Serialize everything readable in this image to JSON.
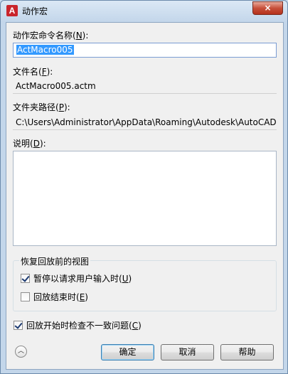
{
  "window": {
    "title": "动作宏",
    "app_icon": "A",
    "close_glyph": "×"
  },
  "form": {
    "macro_name": {
      "label_prefix": "动作宏命令名称(",
      "label_key": "N",
      "label_suffix": "):",
      "value": "ActMacro005"
    },
    "file_name": {
      "label_prefix": "文件名(",
      "label_key": "F",
      "label_suffix": "):",
      "value": "ActMacro005.actm"
    },
    "folder_path": {
      "label_prefix": "文件夹路径(",
      "label_key": "P",
      "label_suffix": "):",
      "value": "C:\\Users\\Administrator\\AppData\\Roaming\\Autodesk\\AutoCAD"
    },
    "description": {
      "label_prefix": "说明(",
      "label_key": "D",
      "label_suffix": "):",
      "value": ""
    }
  },
  "restore_group": {
    "title": "恢复回放前的视图",
    "pause_option": {
      "label_prefix": "暂停以请求用户输入时(",
      "label_key": "U",
      "label_suffix": ")",
      "checked": true
    },
    "end_option": {
      "label_prefix": "回放结束时(",
      "label_key": "E",
      "label_suffix": ")",
      "checked": false
    }
  },
  "check_option": {
    "label_prefix": "回放开始时检查不一致问题(",
    "label_key": "C",
    "label_suffix": ")",
    "checked": true
  },
  "footer": {
    "expand_glyph": "︿",
    "ok_label": "确定",
    "cancel_label": "取消",
    "help_label": "帮助"
  }
}
